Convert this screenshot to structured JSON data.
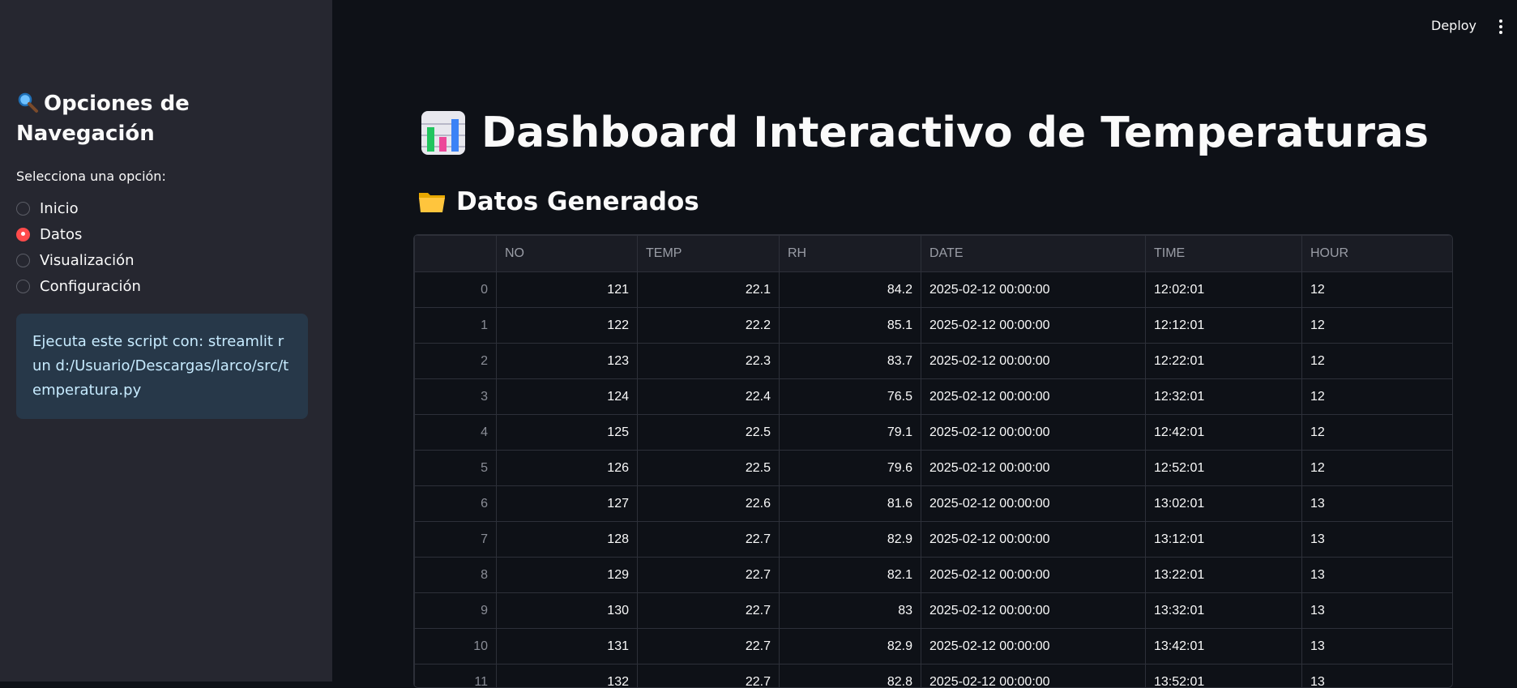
{
  "sidebar": {
    "title_icon": "magnifying-glass-icon",
    "title": "Opciones de Navegación",
    "radio_label": "Selecciona una opción:",
    "options": [
      {
        "label": "Inicio",
        "selected": false
      },
      {
        "label": "Datos",
        "selected": true
      },
      {
        "label": "Visualización",
        "selected": false
      },
      {
        "label": "Configuración",
        "selected": false
      }
    ],
    "info_text": "Ejecuta este script con: streamlit run d:/Usuario/Descargas/larco/src/temperatura.py"
  },
  "header": {
    "deploy_label": "Deploy",
    "menu_icon": "more-vertical-icon"
  },
  "main": {
    "title_icon": "bar-chart-icon",
    "title": "Dashboard Interactivo de Temperaturas",
    "subheader_icon": "folder-icon",
    "subheader": "Datos Generados"
  },
  "table": {
    "columns": [
      "",
      "NO",
      "TEMP",
      "RH",
      "DATE",
      "TIME",
      "HOUR"
    ],
    "rows": [
      [
        "0",
        "121",
        "22.1",
        "84.2",
        "2025-02-12 00:00:00",
        "12:02:01",
        "12"
      ],
      [
        "1",
        "122",
        "22.2",
        "85.1",
        "2025-02-12 00:00:00",
        "12:12:01",
        "12"
      ],
      [
        "2",
        "123",
        "22.3",
        "83.7",
        "2025-02-12 00:00:00",
        "12:22:01",
        "12"
      ],
      [
        "3",
        "124",
        "22.4",
        "76.5",
        "2025-02-12 00:00:00",
        "12:32:01",
        "12"
      ],
      [
        "4",
        "125",
        "22.5",
        "79.1",
        "2025-02-12 00:00:00",
        "12:42:01",
        "12"
      ],
      [
        "5",
        "126",
        "22.5",
        "79.6",
        "2025-02-12 00:00:00",
        "12:52:01",
        "12"
      ],
      [
        "6",
        "127",
        "22.6",
        "81.6",
        "2025-02-12 00:00:00",
        "13:02:01",
        "13"
      ],
      [
        "7",
        "128",
        "22.7",
        "82.9",
        "2025-02-12 00:00:00",
        "13:12:01",
        "13"
      ],
      [
        "8",
        "129",
        "22.7",
        "82.1",
        "2025-02-12 00:00:00",
        "13:22:01",
        "13"
      ],
      [
        "9",
        "130",
        "22.7",
        "83",
        "2025-02-12 00:00:00",
        "13:32:01",
        "13"
      ],
      [
        "10",
        "131",
        "22.7",
        "82.9",
        "2025-02-12 00:00:00",
        "13:42:01",
        "13"
      ],
      [
        "11",
        "132",
        "22.7",
        "82.8",
        "2025-02-12 00:00:00",
        "13:52:01",
        "13"
      ]
    ]
  },
  "colors": {
    "accent": "#ff4b4b",
    "background": "#0e1117",
    "sidebar": "#262730",
    "info_bg": "#273849",
    "info_text": "#c7ebff"
  }
}
